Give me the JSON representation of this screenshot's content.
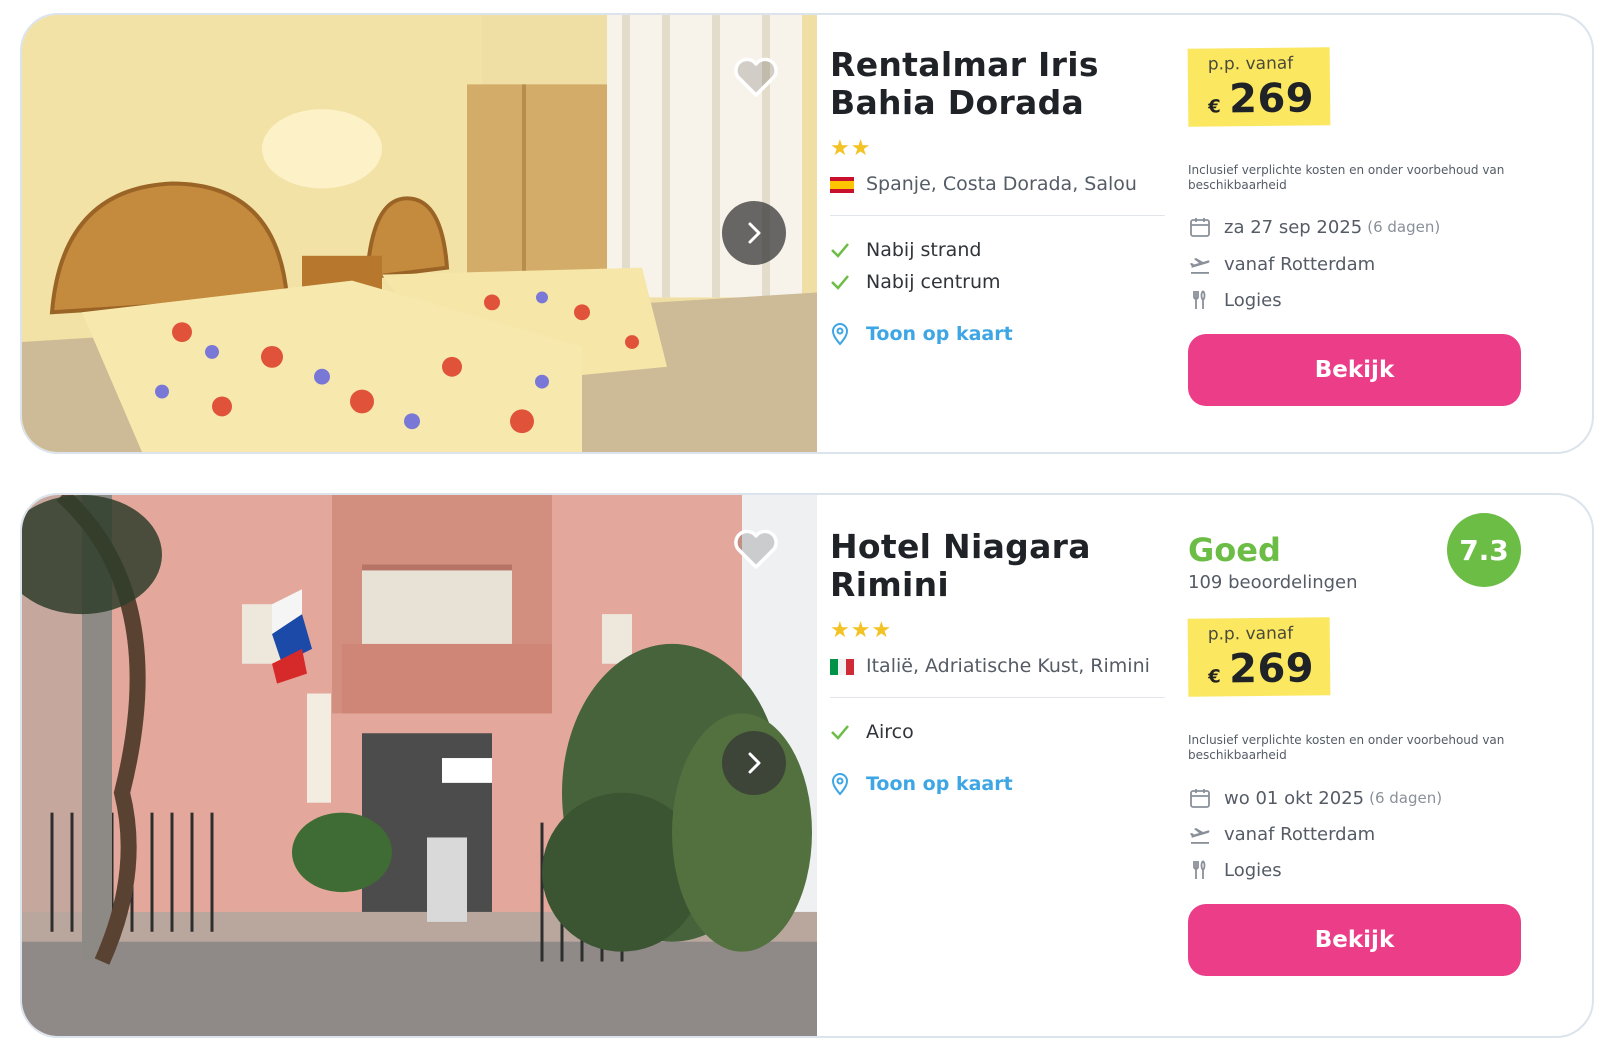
{
  "results": [
    {
      "hotel_name": "Rentalmar Iris Bahia Dorada",
      "stars": "★★",
      "location": "Spanje, Costa Dorada, Salou",
      "features": [
        "Nabij strand",
        "Nabij centrum"
      ],
      "map_link": "Toon op kaart",
      "price_label": "p.p. vanaf",
      "currency": "€",
      "price": "269",
      "disclaimer": "Inclusief verplichte kosten en onder voorbehoud van beschikbaarheid",
      "date": "za 27 sep 2025",
      "duration": "(6 dagen)",
      "departure": "vanaf Rotterdam",
      "board": "Logies",
      "cta": "Bekijk",
      "image": "hotel-room-twin-beds",
      "flag": "spain-flag"
    },
    {
      "hotel_name": "Hotel Niagara Rimini",
      "stars": "★★★",
      "location": "Italië, Adriatische Kust, Rimini",
      "features": [
        "Airco"
      ],
      "map_link": "Toon op kaart",
      "rating_word": "Goed",
      "review_count": "109 beoordelingen",
      "score": "7.3",
      "price_label": "p.p. vanaf",
      "currency": "€",
      "price": "269",
      "disclaimer": "Inclusief verplichte kosten en onder voorbehoud van beschikbaarheid",
      "date": "wo 01 okt 2025",
      "duration": "(6 dagen)",
      "departure": "vanaf Rotterdam",
      "board": "Logies",
      "cta": "Bekijk",
      "image": "hotel-facade-exterior",
      "flag": "italy-flag"
    }
  ],
  "colors": {
    "accent_pink": "#eb3d88",
    "price_yellow": "#fbe760",
    "rating_green": "#6cbd45",
    "link_blue": "#3ea6e4",
    "star_yellow": "#f3c223"
  }
}
